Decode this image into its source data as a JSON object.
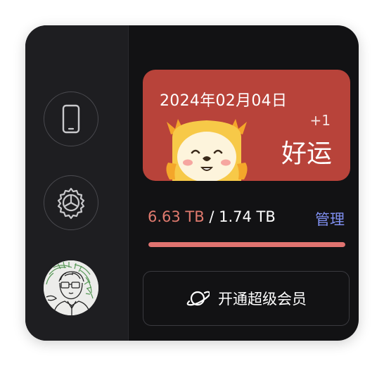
{
  "luck_card": {
    "date": "2024年02月04日",
    "plus": "+1",
    "word": "好运"
  },
  "storage": {
    "used": "6.63 TB",
    "separator": " / ",
    "total": "1.74 TB",
    "manage_label": "管理",
    "progress_fraction": 1.0
  },
  "vip": {
    "label": "开通超级会员"
  },
  "sidebar": {
    "items": [
      {
        "icon": "phone-icon"
      },
      {
        "icon": "settings-gear-icon"
      },
      {
        "icon": "user-avatar"
      }
    ]
  },
  "colors": {
    "card_bg": "#121214",
    "sidebar_bg": "#1e1e21",
    "luck_card_bg": "#b8433a",
    "used_text": "#e07a6e",
    "manage_text": "#7f8ff0",
    "progress_fill": "#e07370"
  }
}
